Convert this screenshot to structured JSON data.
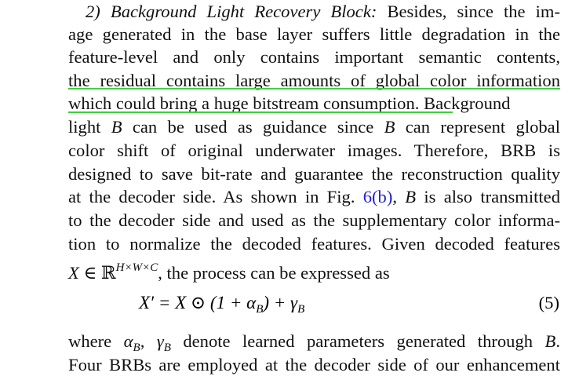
{
  "heading": "2) Background Light Recovery Block:",
  "lines": [
    " Besides, since the im-",
    "age generated in the base layer suffers little degradation in the",
    "feature-level and only contains important semantic contents,",
    "the residual contains large amounts of global color information",
    "which could bring a huge bitstream consumption",
    ". Background",
    "light ",
    " can be used as guidance since ",
    " can represent global",
    "color shift of original underwater images. Therefore, BRB is",
    "designed to save bit-rate and guarantee the reconstruction quality",
    "at the decoder side. As shown in Fig. ",
    "6(b)",
    ", ",
    " is also transmitted",
    "to the decoder side and used as the supplementary color informa-",
    "tion to normalize the decoded features. Given decoded features",
    ", the process can be expressed as"
  ],
  "math": {
    "B": "B",
    "X": "X",
    "in": " ∈ ",
    "R": "ℝ",
    "HWC": "H×W×C"
  },
  "equation": {
    "text": "X′ = X ⊙ (1 + α",
    "sub1": "B",
    "mid": ") + γ",
    "sub2": "B",
    "number": "(5)"
  },
  "after": {
    "pre": "where ",
    "alpha": "α",
    "subA": "B",
    "comma": ", ",
    "gamma": "γ",
    "subG": "B",
    "post": " denote learned parameters generated through ",
    "B": "B",
    "end": ".",
    "last": "Four BRBs are employed at the decoder side of our enhancement"
  },
  "highlight_color": "#3fcf3f",
  "link_color": "#1f1fd6"
}
